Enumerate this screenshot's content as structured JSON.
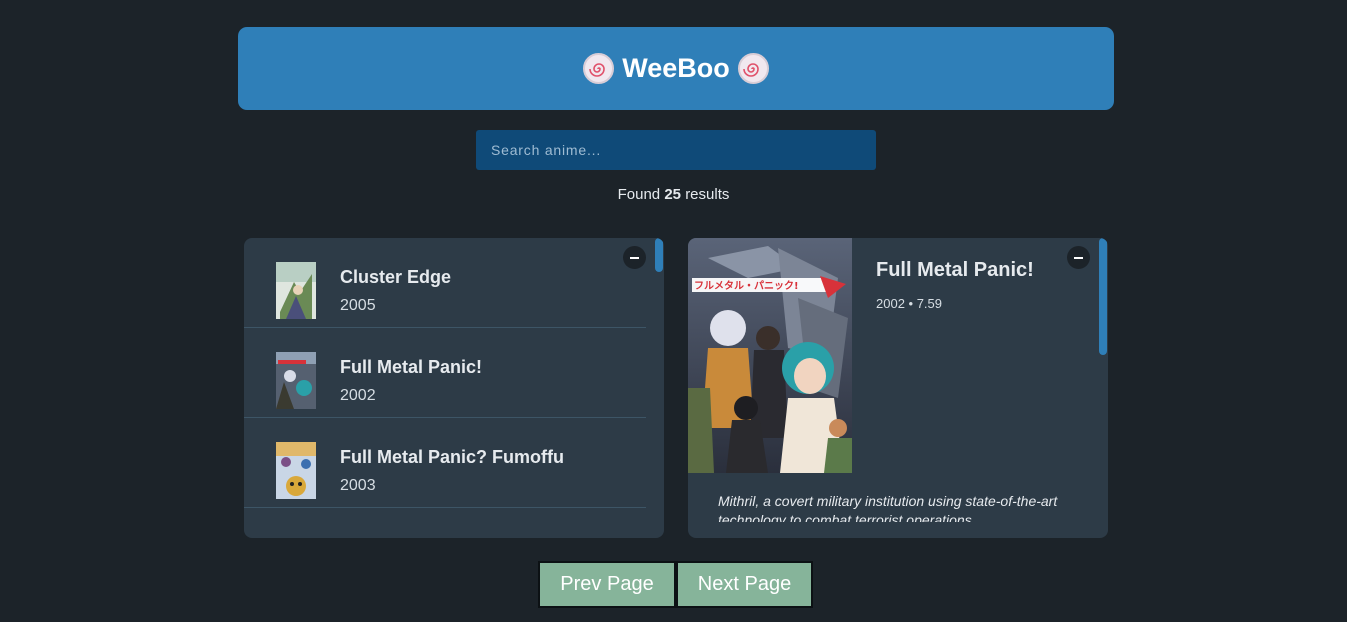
{
  "app": {
    "title": "WeeBoo",
    "logo_icon": "naruto-fishcake-icon",
    "accent_color": "#2f7fb8"
  },
  "search": {
    "placeholder": "Search anime...",
    "value": ""
  },
  "results": {
    "prefix": "Found",
    "count": "25",
    "suffix": "results"
  },
  "list": {
    "minimize_icon": "minus-icon",
    "items": [
      {
        "title": "Cluster Edge",
        "year": "2005"
      },
      {
        "title": "Full Metal Panic!",
        "year": "2002"
      },
      {
        "title": "Full Metal Panic? Fumoffu",
        "year": "2003"
      }
    ]
  },
  "detail": {
    "title": "Full Metal Panic!",
    "meta": "2002 • 7.59",
    "description": "Mithril, a covert military institution using state-of-the-art technology to combat terrorist operations",
    "poster_text": "フルメタル・パニック!",
    "minimize_icon": "minus-icon"
  },
  "pagination": {
    "prev_label": "Prev Page",
    "next_label": "Next Page",
    "button_color": "#86b49a"
  }
}
